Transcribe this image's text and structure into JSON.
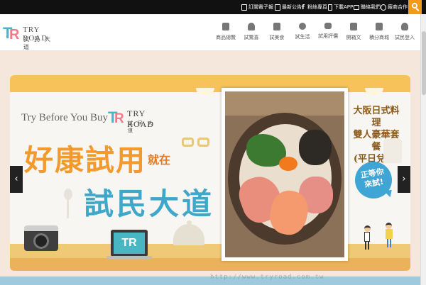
{
  "topbar": {
    "links": [
      {
        "label": "訂閱電子報",
        "icon": "newsletter-icon"
      },
      {
        "label": "最新公告",
        "icon": "announcement-icon"
      },
      {
        "label": "粉絲專頁",
        "icon": "facebook-icon"
      },
      {
        "label": "下載APP",
        "icon": "mobile-icon"
      },
      {
        "label": "聯絡我們",
        "icon": "mail-icon"
      },
      {
        "label": "廠商合作",
        "icon": "handshake-icon"
      }
    ],
    "search_icon": "search-icon",
    "accent": "#f39a18"
  },
  "header": {
    "logo": {
      "mark_t": "T",
      "mark_r": "R",
      "name": "TRY ROAD",
      "sub": "試民大道"
    },
    "nav": [
      {
        "label": "商品總覽",
        "icon": "gift-icon"
      },
      {
        "label": "試驚喜",
        "icon": "sparkle-icon"
      },
      {
        "label": "試美食",
        "icon": "food-icon"
      },
      {
        "label": "試生活",
        "icon": "life-icon"
      },
      {
        "label": "試用評價",
        "icon": "chat-icon"
      },
      {
        "label": "開箱文",
        "icon": "box-icon"
      },
      {
        "label": "積分商城",
        "icon": "shopping-bag-icon"
      },
      {
        "label": "試民登入",
        "icon": "user-icon"
      }
    ]
  },
  "banner": {
    "tagline": "Try Before You Buy",
    "logo": {
      "mark_t": "T",
      "mark_r": "R",
      "name": "TRY ROAD",
      "sub": "試民大道"
    },
    "headline_1": "好康試用",
    "headline_mid": "就在",
    "headline_2": "試民大道",
    "laptop_text": "TR",
    "offer_lines": [
      "大阪日式料理",
      "雙人豪華套餐",
      "(平日兌換)"
    ],
    "bubble_lines": [
      "正等你",
      "來試!"
    ],
    "prev_label": "‹",
    "next_label": "›",
    "colors": {
      "orange": "#f29a2e",
      "blue": "#3fa7c9",
      "strip": "#f6c259"
    }
  },
  "watermark": "http://www.tryroad.com.tw"
}
